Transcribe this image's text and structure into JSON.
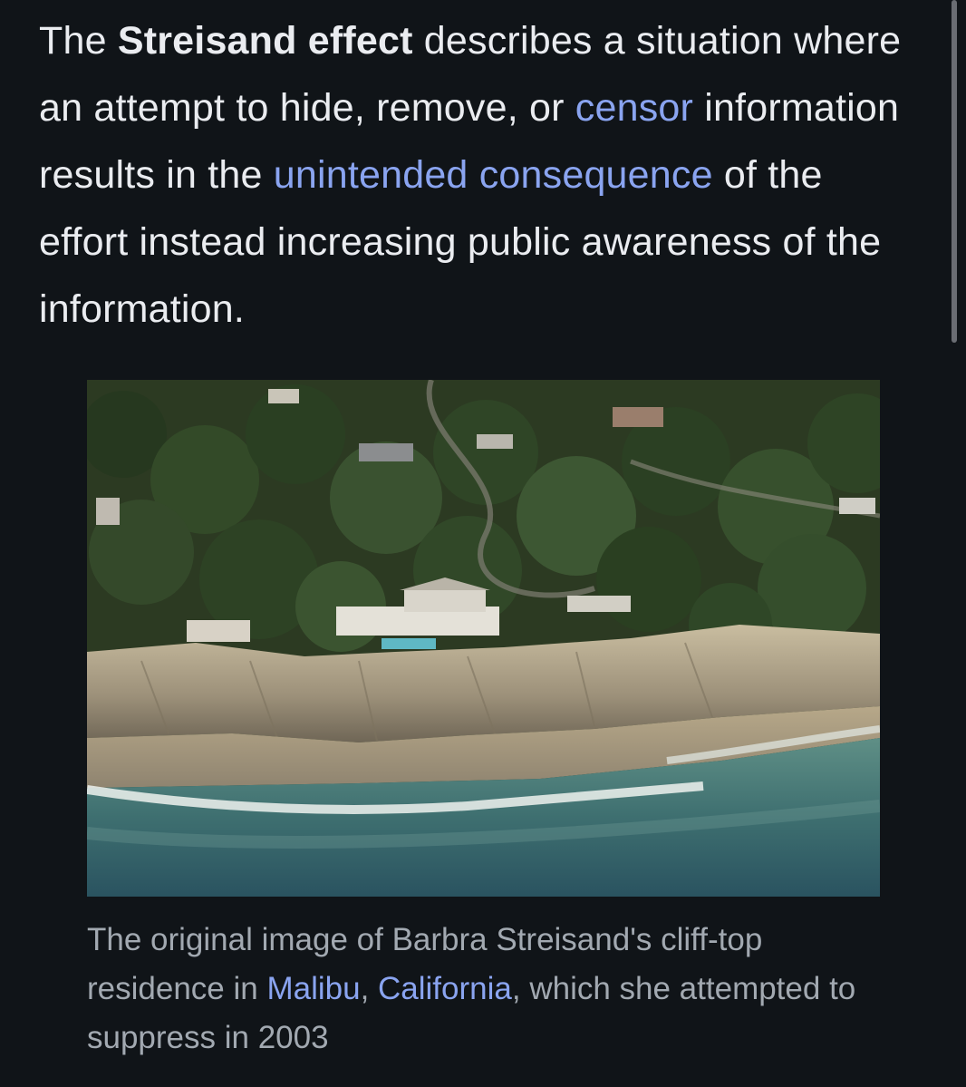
{
  "paragraph": {
    "intro": "The ",
    "term": "Streisand effect",
    "part1": " describes a situation where an attempt to hide, remove, or ",
    "link_censor": "censor",
    "part2": " information results in the ",
    "link_consequence": "unintended consequence",
    "part3": " of the effort instead increasing public awareness of the information."
  },
  "figure": {
    "image_subject": "aerial-photo-cliff-top-residence-malibu",
    "caption_part1": "The original image of Barbra Streisand's cliff-top residence in ",
    "caption_link_malibu": "Malibu",
    "caption_sep": ", ",
    "caption_link_california": "California",
    "caption_part2": ", which she attempted to suppress in 2003"
  },
  "colors": {
    "background": "#101418",
    "text": "#eaecf0",
    "link": "#8aa4f0",
    "caption": "#a2a9b1"
  }
}
